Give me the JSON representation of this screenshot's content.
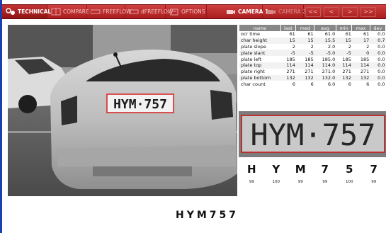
{
  "toolbar": {
    "buttons": [
      {
        "label": "TECHNICAL",
        "icon": "technical-icon"
      },
      {
        "label": "COMPARE",
        "icon": "compare-icon"
      },
      {
        "label": "FREEFLOW",
        "icon": "freeflow-icon"
      },
      {
        "label": "dFREEFLOW",
        "icon": "dfreeflow-icon"
      },
      {
        "label": "OPTIONS",
        "icon": "options-icon"
      },
      {
        "label": "CAMERA 1",
        "icon": "camera-icon"
      },
      {
        "label": "CAMERA 2",
        "icon": "camera-icon"
      }
    ],
    "nav": [
      "<<",
      "<",
      ">",
      ">>"
    ]
  },
  "camera_view": {
    "plate_text": "HYM·757"
  },
  "stats": {
    "columns": [
      "name",
      "last",
      "med",
      "avg",
      "min",
      "max",
      "dev"
    ],
    "rows": [
      [
        "ocr time",
        "61",
        "61",
        "61.0",
        "61",
        "61",
        "0.0"
      ],
      [
        "char height",
        "15",
        "15",
        "15.5",
        "15",
        "17",
        "0.7"
      ],
      [
        "plate slope",
        "2",
        "2",
        "2.0",
        "2",
        "2",
        "0.0"
      ],
      [
        "plate slant",
        "-5",
        "-5",
        "-5.0",
        "-5",
        "0",
        "0.0"
      ],
      [
        "plate left",
        "185",
        "185",
        "185.0",
        "185",
        "185",
        "0.0"
      ],
      [
        "plate top",
        "114",
        "114",
        "114.0",
        "114",
        "114",
        "0.0"
      ],
      [
        "plate right",
        "271",
        "271",
        "271.0",
        "271",
        "271",
        "0.0"
      ],
      [
        "plate bottom",
        "132",
        "132",
        "132.0",
        "132",
        "132",
        "0.0"
      ],
      [
        "char count",
        "6",
        "6",
        "6.0",
        "6",
        "6",
        "0.0"
      ]
    ]
  },
  "plate_crop": {
    "text": "HYM·757"
  },
  "characters": [
    {
      "char": "H",
      "confidence": "99"
    },
    {
      "char": "Y",
      "confidence": "100"
    },
    {
      "char": "M",
      "confidence": "99"
    },
    {
      "char": "7",
      "confidence": "99"
    },
    {
      "char": "5",
      "confidence": "100"
    },
    {
      "char": "7",
      "confidence": "99"
    }
  ],
  "result": "HYM757",
  "colors": {
    "toolbar": "#b82626",
    "border": "#1a3fb0",
    "plate_box": "#d81e1e"
  }
}
